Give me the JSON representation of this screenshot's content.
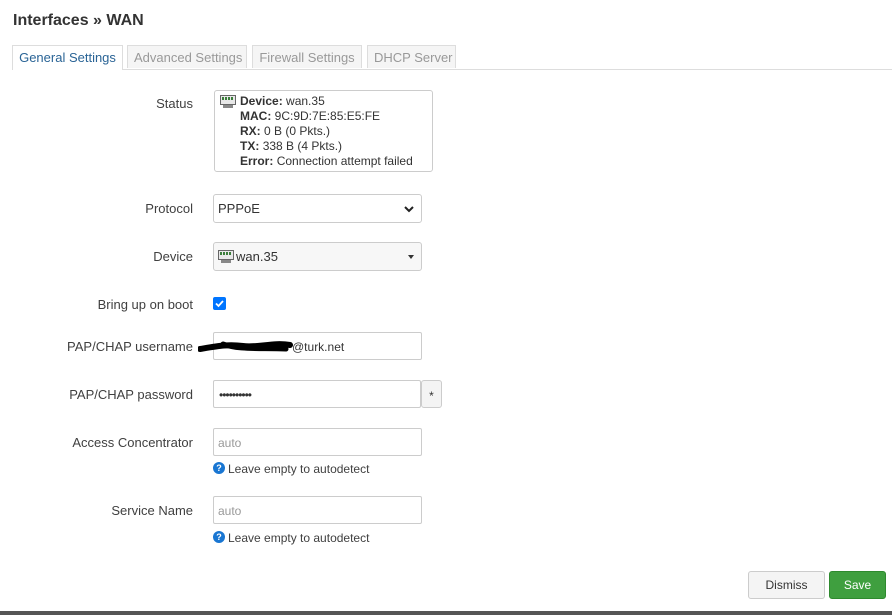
{
  "page": {
    "title": "Interfaces » WAN"
  },
  "tabs": [
    {
      "label": "General Settings",
      "active": true
    },
    {
      "label": "Advanced Settings",
      "active": false
    },
    {
      "label": "Firewall Settings",
      "active": false
    },
    {
      "label": "DHCP Server",
      "active": false
    }
  ],
  "status": {
    "label": "Status",
    "icon": "ethernet-port-icon",
    "device_key": "Device:",
    "device_val": "wan.35",
    "mac_key": "MAC:",
    "mac_val": "9C:9D:7E:85:E5:FE",
    "rx_key": "RX:",
    "rx_val": "0 B (0 Pkts.)",
    "tx_key": "TX:",
    "tx_val": "338 B (4 Pkts.)",
    "error_key": "Error:",
    "error_val": "Connection attempt failed"
  },
  "protocol": {
    "label": "Protocol",
    "value": "PPPoE"
  },
  "device": {
    "label": "Device",
    "value": "wan.35",
    "icon": "ethernet-port-icon"
  },
  "bring_up": {
    "label": "Bring up on boot",
    "checked": true
  },
  "username": {
    "label": "PAP/CHAP username",
    "value": "@turk.net"
  },
  "password": {
    "label": "PAP/CHAP password",
    "value": "••••••••••",
    "reveal": "*"
  },
  "access_concentrator": {
    "label": "Access Concentrator",
    "placeholder": "auto",
    "hint": "Leave empty to autodetect"
  },
  "service_name": {
    "label": "Service Name",
    "placeholder": "auto",
    "hint": "Leave empty to autodetect"
  },
  "buttons": {
    "dismiss": "Dismiss",
    "save": "Save"
  },
  "colors": {
    "save_bg": "#3f9f3f",
    "active_tab_text": "#2a6496",
    "checkbox": "#0075ff",
    "help_icon": "#1976d2"
  }
}
